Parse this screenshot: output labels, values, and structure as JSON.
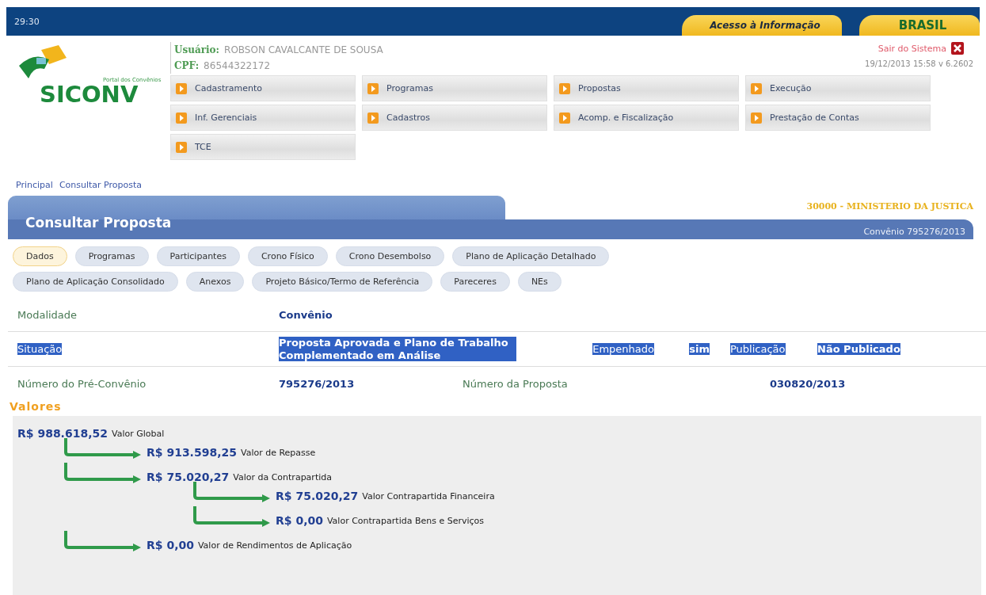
{
  "top_bar": {
    "timer": "29:30",
    "links": [
      {
        "label": "Acesso à Informação",
        "kind": "access"
      },
      {
        "label": "BRASIL",
        "kind": "brand"
      }
    ]
  },
  "logo": {
    "subtitle": "Portal dos Convênios",
    "name": "SICONV"
  },
  "user": {
    "user_label": "Usuário:",
    "user_name": "ROBSON CAVALCANTE DE SOUSA",
    "cpf_label": "CPF:",
    "cpf": "86544322172"
  },
  "logout": {
    "label": "Sair do Sistema",
    "timestamp": "19/12/2013 15:58 v 6.2602"
  },
  "menu": [
    "Cadastramento",
    "Programas",
    "Propostas",
    "Execução",
    "Inf. Gerenciais",
    "Cadastros",
    "Acomp. e Fiscalização",
    "Prestação de Contas",
    "TCE"
  ],
  "breadcrumb": [
    "Principal",
    "Consultar Proposta"
  ],
  "panel": {
    "title": "Consultar Proposta",
    "organ": "30000 - MINISTERIO DA JUSTICA",
    "reference": "Convênio 795276/2013"
  },
  "tabs": [
    {
      "label": "Dados",
      "selected": true
    },
    {
      "label": "Programas",
      "selected": false
    },
    {
      "label": "Participantes",
      "selected": false
    },
    {
      "label": "Crono Físico",
      "selected": false
    },
    {
      "label": "Crono Desembolso",
      "selected": false
    },
    {
      "label": "Plano de Aplicação Detalhado",
      "selected": false
    },
    {
      "label": "Plano de Aplicação Consolidado",
      "selected": false
    },
    {
      "label": "Anexos",
      "selected": false
    },
    {
      "label": "Projeto Básico/Termo de Referência",
      "selected": false
    },
    {
      "label": "Pareceres",
      "selected": false
    },
    {
      "label": "NEs",
      "selected": false
    }
  ],
  "fields": [
    {
      "highlighted": false,
      "pairs": [
        {
          "label": "Modalidade",
          "value": "Convênio"
        }
      ]
    },
    {
      "highlighted": true,
      "pairs": [
        {
          "label": "Situação",
          "value": "Proposta Aprovada e Plano de Trabalho Complementado em Análise"
        },
        {
          "label": "Empenhado",
          "value": "sim"
        },
        {
          "label": "Publicação",
          "value": "Não Publicado"
        }
      ]
    },
    {
      "highlighted": false,
      "pairs": [
        {
          "label": "Número do Pré-Convênio",
          "value": "795276/2013"
        },
        {
          "label": "Número da Proposta",
          "value": "030820/2013"
        }
      ]
    }
  ],
  "values": {
    "title": "Valores",
    "tree": [
      {
        "amount": "R$ 988.618,52",
        "label": "Valor Global",
        "children": [
          {
            "amount": "R$ 913.598,25",
            "label": "Valor de Repasse"
          },
          {
            "amount": "R$ 75.020,27",
            "label": "Valor da Contrapartida",
            "children": [
              {
                "amount": "R$ 75.020,27",
                "label": "Valor Contrapartida Financeira"
              },
              {
                "amount": "R$ 0,00",
                "label": "Valor Contrapartida Bens e Serviços"
              }
            ]
          },
          {
            "amount": "R$ 0,00",
            "label": "Valor de Rendimentos de Aplicação"
          }
        ]
      }
    ]
  }
}
